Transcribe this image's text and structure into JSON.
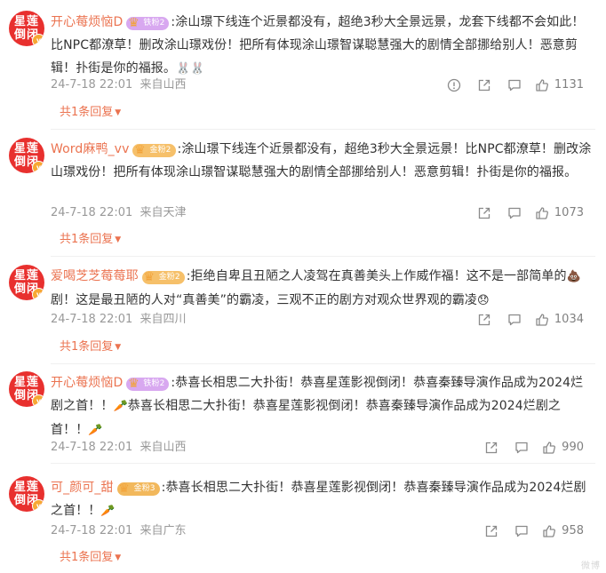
{
  "comments": [
    {
      "avatar_text": [
        "星莲",
        "倒闭"
      ],
      "username": "开心莓烦恼D",
      "badge": "铁粉2",
      "text": ":涂山璟下线连个近景都没有，超绝3秒大全景远景，龙套下线都不会如此！比NPC都潦草！删改涂山璟戏份！把所有体现涂山璟智谋聪慧强大的剧情全部挪给别人！恶意剪辑！扑街是你的福报。",
      "emoji_tail": "🐰🐰",
      "time": "24-7-18 22:01",
      "location": "来自山西",
      "likes": "1131",
      "replies": "共1条回复"
    },
    {
      "avatar_text": [
        "星莲",
        "倒闭"
      ],
      "username": "Word麻鸭_vv",
      "badge": "金粉2",
      "text": ":涂山璟下线连个近景都没有，超绝3秒大全景远景！比NPC都潦草！删改涂山璟戏份！把所有体现涂山璟智谋聪慧强大的剧情全部挪给别人！恶意剪辑！扑街是你的福报。",
      "emoji_tail": "",
      "time": "24-7-18 22:01",
      "location": "来自天津",
      "likes": "1073",
      "replies": "共1条回复"
    },
    {
      "avatar_text": [
        "星莲",
        "倒闭"
      ],
      "username": "爱喝芝芝莓莓耶",
      "badge": "金粉2",
      "text_part1": ":拒绝自卑且丑陋之人凌驾在真善美头上作威作福！这不是一部简单的",
      "text_part2": "剧！这是最丑陋的人对“真善美”的霸凌，三观不正的剧方对观众世界观的霸凌",
      "time": "24-7-18 22:01",
      "location": "来自四川",
      "likes": "1034",
      "replies": "共1条回复"
    },
    {
      "avatar_text": [
        "星莲",
        "倒闭"
      ],
      "username": "开心莓烦恼D",
      "badge": "铁粉2",
      "text_part1": ":恭喜长相思二大扑街！恭喜星莲影视倒闭！恭喜秦臻导演作品成为2024烂剧之首！！",
      "text_part2": "恭喜长相思二大扑街！恭喜星莲影视倒闭！恭喜秦臻导演作品成为2024烂剧之首！！",
      "time": "24-7-18 22:01",
      "location": "来自山西",
      "likes": "990",
      "replies": ""
    },
    {
      "avatar_text": [
        "星莲",
        "倒闭"
      ],
      "username": "可_颜可_甜",
      "badge": "金粉3",
      "text": ":恭喜长相思二大扑街！恭喜星莲影视倒闭！恭喜秦臻导演作品成为2024烂剧之首！！",
      "time": "24-7-18 22:01",
      "location": "来自广东",
      "likes": "958",
      "replies": "共1条回复"
    }
  ],
  "watermark": "微博",
  "colors": {
    "username": "#eb7350",
    "meta": "#999999",
    "avatar_bg": "#e8302e"
  }
}
